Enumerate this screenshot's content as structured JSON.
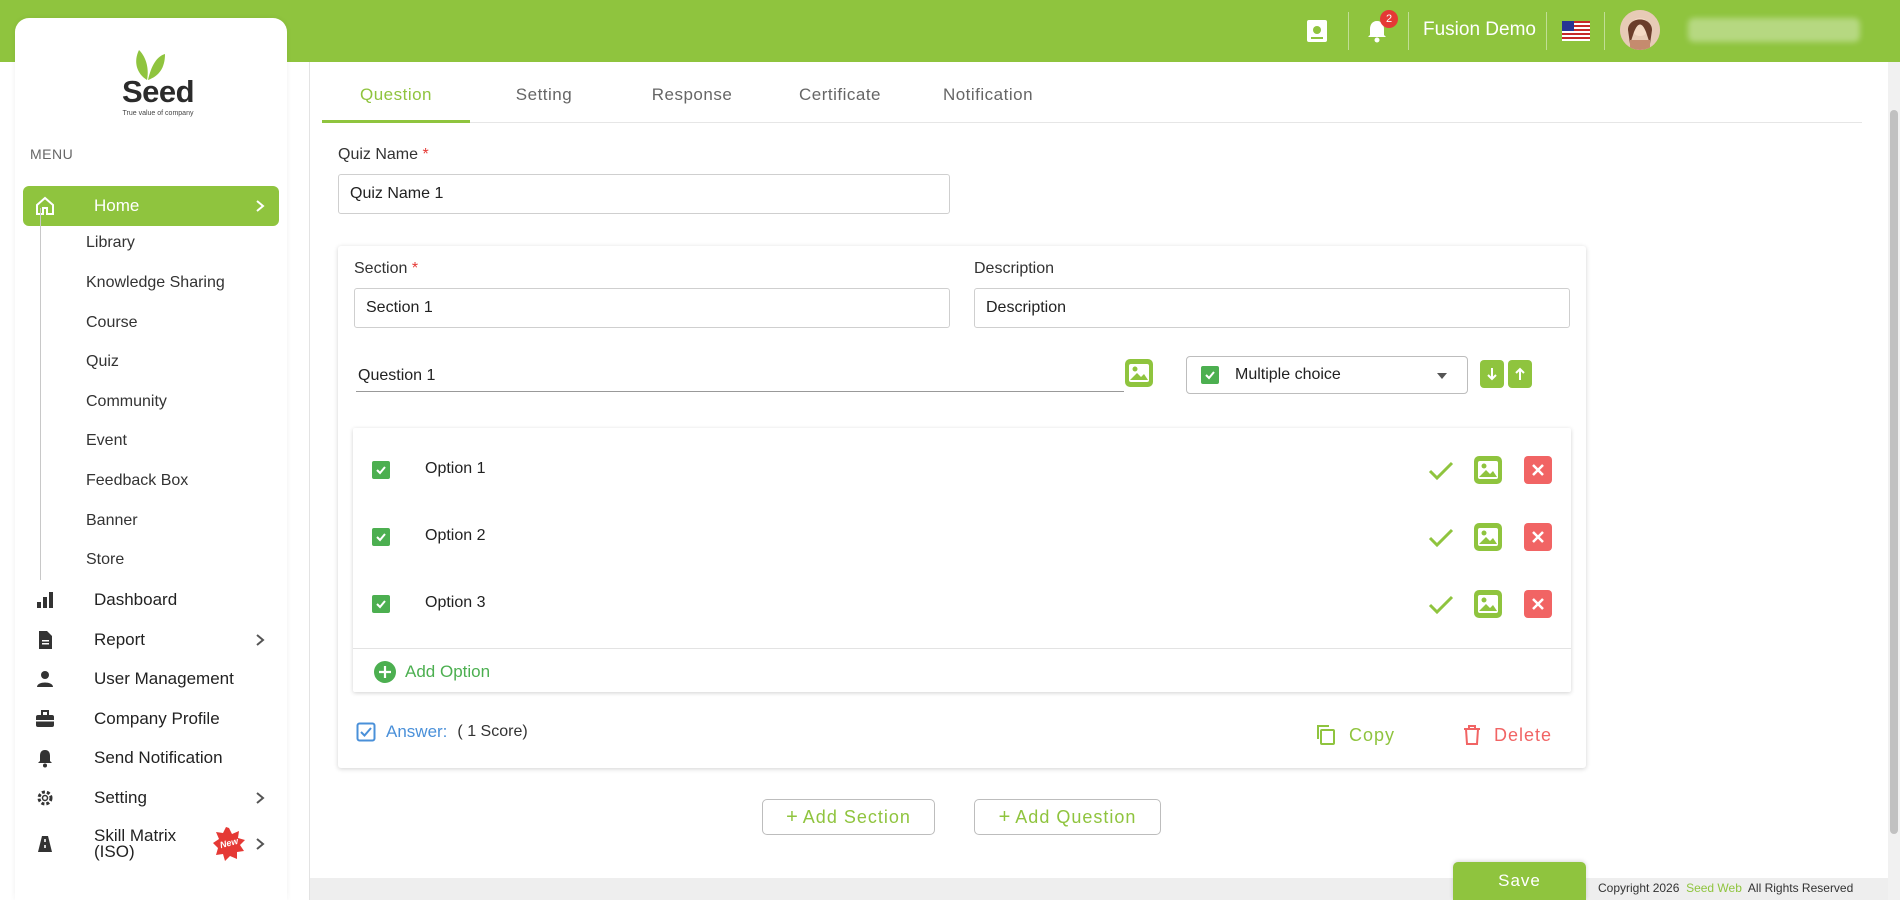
{
  "header": {
    "user_name": "Fusion Demo",
    "notification_count": "2"
  },
  "sidebar": {
    "logo_word": "Seed",
    "logo_tagline": "True value of company",
    "menu_label": "MENU",
    "home": "Home",
    "home_sub": [
      "Library",
      "Knowledge Sharing",
      "Course",
      "Quiz",
      "Community",
      "Event",
      "Feedback Box",
      "Banner",
      "Store"
    ],
    "dashboard": "Dashboard",
    "report": "Report",
    "user_management": "User Management",
    "company_profile": "Company Profile",
    "send_notification": "Send Notification",
    "setting": "Setting",
    "skill_matrix_1": "Skill Matrix",
    "skill_matrix_2": "(ISO)",
    "new_badge": "New"
  },
  "tabs": [
    "Question",
    "Setting",
    "Response",
    "Certificate",
    "Notification"
  ],
  "form": {
    "quiz_name_label": "Quiz Name",
    "quiz_name_value": "Quiz Name 1",
    "section_label": "Section",
    "section_value": "Section 1",
    "description_label": "Description",
    "description_value": "Description",
    "question_value": "Question 1",
    "question_type": "Multiple choice",
    "options": [
      "Option 1",
      "Option 2",
      "Option 3"
    ],
    "add_option": "Add Option",
    "answer_label": "Answer:",
    "score": "( 1 Score)",
    "copy": "Copy",
    "delete": "Delete",
    "add_section": "Add Section",
    "add_question": "Add Question",
    "save": "Save"
  },
  "footer": {
    "copyright_prefix": "Copyright 2026",
    "brand": "Seed Web",
    "rights": "All Rights Reserved"
  },
  "colors": {
    "brand_green": "#8fc43e",
    "checkbox_green": "#4caf50",
    "danger_red": "#f16464",
    "link_blue": "#4a90d9"
  }
}
